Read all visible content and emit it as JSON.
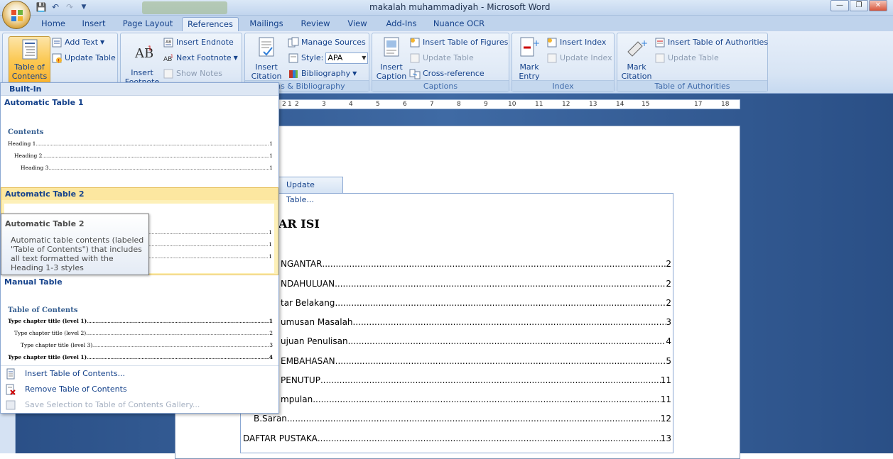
{
  "window": {
    "title": "makalah muhammadiyah - Microsoft Word",
    "controls": [
      "minimize",
      "restore",
      "close"
    ]
  },
  "tabs": [
    {
      "label": "Home",
      "active": false
    },
    {
      "label": "Insert",
      "active": false
    },
    {
      "label": "Page Layout",
      "active": false
    },
    {
      "label": "References",
      "active": true
    },
    {
      "label": "Mailings",
      "active": false
    },
    {
      "label": "Review",
      "active": false
    },
    {
      "label": "View",
      "active": false
    },
    {
      "label": "Add-Ins",
      "active": false
    },
    {
      "label": "Nuance OCR",
      "active": false
    }
  ],
  "ribbon": {
    "toc_group": {
      "toc_button": "Table of\nContents",
      "add_text": "Add Text",
      "update_table": "Update Table"
    },
    "footnotes_group": {
      "insert_footnote": "Insert\nFootnote",
      "insert_endnote": "Insert Endnote",
      "next_footnote": "Next Footnote",
      "show_notes": "Show Notes"
    },
    "citations_group": {
      "label": "ions & Bibliography",
      "insert_citation": "Insert\nCitation",
      "manage_sources": "Manage Sources",
      "style_label": "Style:",
      "style_value": "APA",
      "bibliography": "Bibliography"
    },
    "captions_group": {
      "label": "Captions",
      "insert_caption": "Insert\nCaption",
      "insert_table_of_figures": "Insert Table of Figures",
      "update_table": "Update Table",
      "cross_reference": "Cross-reference"
    },
    "index_group": {
      "label": "Index",
      "mark_entry": "Mark\nEntry",
      "insert_index": "Insert Index",
      "update_index": "Update Index"
    },
    "authorities_group": {
      "label": "Table of Authorities",
      "mark_citation": "Mark\nCitation",
      "insert_table_of_authorities": "Insert Table of Authorities",
      "update_table": "Update Table"
    }
  },
  "ruler": {
    "numbers": [
      "2",
      "1",
      "2",
      "3",
      "4",
      "5",
      "6",
      "7",
      "8",
      "9",
      "10",
      "11",
      "12",
      "13",
      "14",
      "15",
      "17",
      "18"
    ]
  },
  "gallery": {
    "header": "Built-In",
    "items": [
      {
        "title": "Automatic Table 1",
        "heading": "Contents",
        "lines": [
          {
            "label": "Heading 1",
            "page": "1"
          },
          {
            "label": "Heading 2",
            "page": "1"
          },
          {
            "label": "Heading 3",
            "page": "1"
          }
        ]
      },
      {
        "title": "Automatic Table 2",
        "lines": [
          {
            "page": "1"
          },
          {
            "page": "1"
          },
          {
            "page": "1"
          }
        ]
      },
      {
        "title": "Manual Table",
        "heading": "Table of Contents",
        "lines": [
          {
            "label": "Type chapter title (level 1)",
            "page": "1"
          },
          {
            "label": "Type chapter title (level 2)",
            "page": "2"
          },
          {
            "label": "Type chapter title (level 3)",
            "page": "3"
          },
          {
            "label": "Type chapter title (level 1)",
            "page": "4"
          }
        ]
      }
    ],
    "menu": [
      {
        "label": "Insert Table of Contents...",
        "disabled": false
      },
      {
        "label": "Remove Table of Contents",
        "disabled": false
      },
      {
        "label": "Save Selection to Table of Contents Gallery...",
        "disabled": true
      }
    ]
  },
  "tooltip": {
    "title": "Automatic Table 2",
    "body": "Automatic table contents (labeled \"Table of Contents\") that includes all text formatted with the Heading 1-3 styles"
  },
  "document": {
    "update_table_tab": "Update Table...",
    "title": "AR ISI",
    "toc": [
      {
        "label": "NGANTAR",
        "page": "2"
      },
      {
        "label": "NDAHULUAN",
        "page": "2"
      },
      {
        "label": "tar Belakang ",
        "page": "2"
      },
      {
        "label": "umusan Masalah",
        "page": "3"
      },
      {
        "label": "ujuan Penulisan",
        "page": "4"
      },
      {
        "label": "EMBAHASAN",
        "page": "5"
      },
      {
        "label": "PENUTUP ",
        "page": "11"
      },
      {
        "label": "mpulan",
        "page": "11"
      },
      {
        "label": "B.Saran",
        "page": "12"
      },
      {
        "label": "DAFTAR PUSTAKA",
        "page": "13"
      }
    ]
  }
}
